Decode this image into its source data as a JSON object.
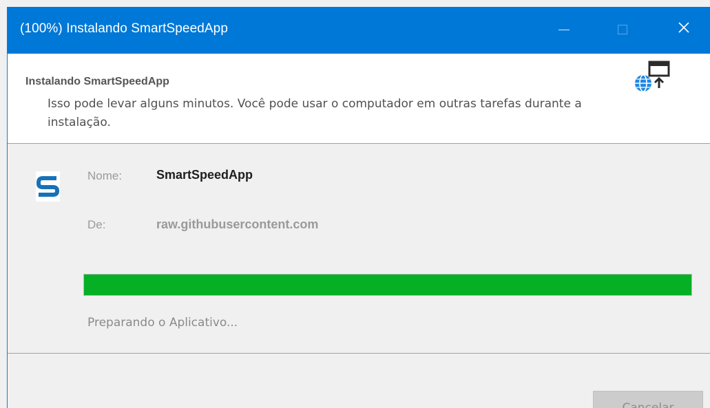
{
  "window": {
    "title": "(100%) Instalando SmartSpeedApp"
  },
  "titlebar_buttons": {
    "minimize": "minimize-icon",
    "maximize": "maximize-icon",
    "close": "close-icon"
  },
  "header": {
    "title": "Instalando SmartSpeedApp",
    "description": "Isso pode levar alguns minutos. Você pode usar o computador em outras tarefas durante a instalação.",
    "icon": "globe-install-icon"
  },
  "app": {
    "icon": "smartspeedapp-logo-icon",
    "name_label": "Nome:",
    "name": "SmartSpeedApp",
    "from_label": "De:",
    "from": "raw.githubusercontent.com"
  },
  "progress": {
    "percent": 100,
    "status": "Preparando o Aplicativo..."
  },
  "footer": {
    "cancel_label": "Cancelar"
  },
  "colors": {
    "titlebar": "#0078d7",
    "progress": "#06b025",
    "brand": "#1672b8"
  }
}
